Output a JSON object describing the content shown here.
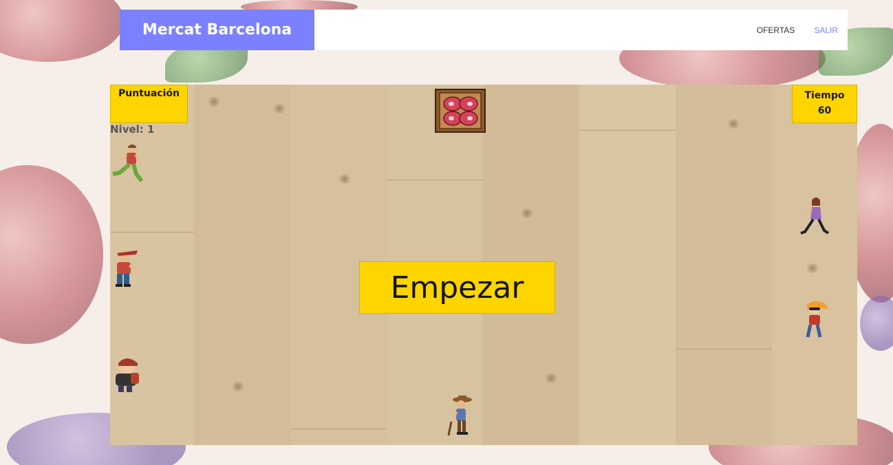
{
  "navbar": {
    "brand": "Mercat Barcelona",
    "links": [
      {
        "label": "OFERTAS",
        "active": false
      },
      {
        "label": "SALIR",
        "active": true
      }
    ]
  },
  "hud": {
    "score_label": "Puntuación",
    "time_label": "Tiempo",
    "time_value": "60",
    "level_text": "Nivel: 1"
  },
  "game": {
    "start_label": "Empezar",
    "sprites": [
      "meat-crate",
      "runner-green-pants",
      "kid-red-cap",
      "kid-backpack",
      "woman-purple-dress",
      "girl-sunglasses",
      "old-man-cane"
    ]
  },
  "colors": {
    "brand": "#7b80ff",
    "hud_yellow": "#ffd500",
    "floor": "#d7c29f"
  }
}
